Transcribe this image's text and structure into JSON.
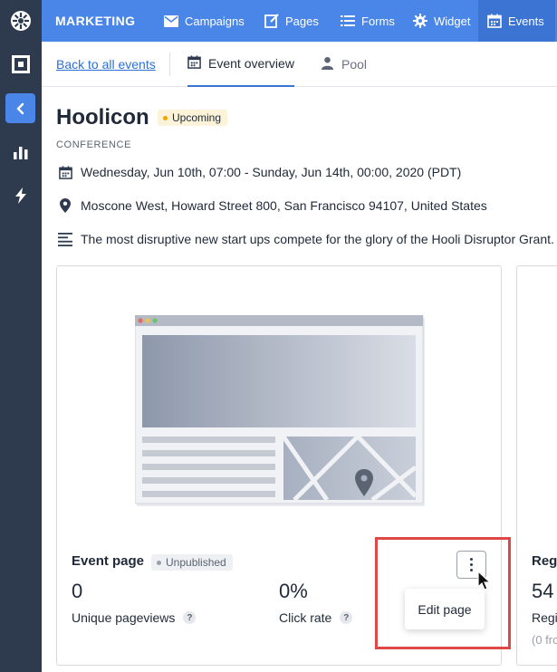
{
  "app": {
    "brand": "MARKETING"
  },
  "topnav": {
    "items": [
      {
        "label": "Campaigns",
        "icon": "envelope-icon"
      },
      {
        "label": "Pages",
        "icon": "edit-page-icon"
      },
      {
        "label": "Forms",
        "icon": "list-icon"
      },
      {
        "label": "Widget",
        "icon": "gear-icon"
      },
      {
        "label": "Events",
        "icon": "calendar-icon",
        "active": true
      }
    ]
  },
  "subnav": {
    "back_link": "Back to all events",
    "tabs": [
      {
        "label": "Event overview",
        "icon": "calendar-icon",
        "active": true
      },
      {
        "label": "Pool",
        "icon": "person-icon",
        "active": false
      }
    ]
  },
  "event": {
    "title": "Hoolicon",
    "status": "Upcoming",
    "type": "CONFERENCE",
    "date": "Wednesday, Jun 10th, 07:00 - Sunday, Jun 14th, 00:00, 2020 (PDT)",
    "location": "Moscone West, Howard Street 800, San Francisco 94107, United States",
    "description": "The most disruptive new start ups compete for the glory of the Hooli Disruptor Grant."
  },
  "event_page_card": {
    "title": "Event page",
    "status": "Unpublished",
    "stats": [
      {
        "value": "0",
        "label": "Unique pageviews",
        "help": "?"
      },
      {
        "value": "0%",
        "label": "Click rate",
        "help": "?"
      }
    ],
    "menu": {
      "items": [
        "Edit page"
      ]
    }
  },
  "side_card": {
    "title": "Reg",
    "value": "54",
    "label": "Regi",
    "sub": "(0 fro"
  },
  "colors": {
    "rail": "#2e3a4e",
    "topbar": "#4a86e8",
    "topbar_active": "#3c74d4",
    "highlight": "#e04848",
    "upcoming_dot": "#f0a500"
  }
}
